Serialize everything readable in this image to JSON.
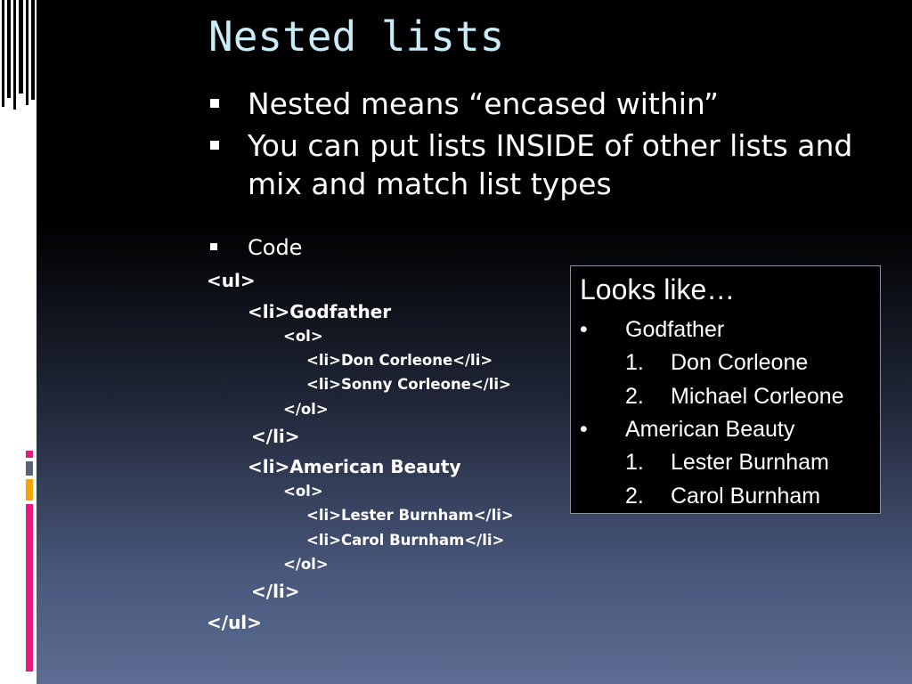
{
  "slide": {
    "title": "Nested lists",
    "bullets": [
      "Nested means “encased within”",
      "You can put lists INSIDE of other lists and mix and match list types"
    ],
    "code_label": "Code",
    "code_lines": [
      "<ul>",
      "<li>Godfather",
      "<ol>",
      "<li>Don Corleone</li>",
      "<li>Sonny Corleone</li>",
      "</ol>",
      "</li>",
      "<li>American Beauty",
      "<ol>",
      "<li>Lester Burnham</li>",
      "<li>Carol Burnham</li>",
      "</ol>",
      "</li>",
      "</ul>"
    ]
  },
  "preview": {
    "title": "Looks like…",
    "bullet_marker": "•",
    "items": [
      {
        "label": "Godfather",
        "children": [
          {
            "marker": "1.",
            "label": "Don Corleone"
          },
          {
            "marker": "2.",
            "label": "Michael Corleone"
          }
        ]
      },
      {
        "label": "American Beauty",
        "children": [
          {
            "marker": "1.",
            "label": "Lester Burnham"
          },
          {
            "marker": "2.",
            "label": "Carol Burnham"
          }
        ]
      }
    ]
  },
  "colors": {
    "title": "#c9ecf9",
    "text": "#ffffff",
    "background_top": "#000000",
    "background_bottom": "#5d6d93",
    "accent_pink": "#e8197e",
    "accent_orange": "#f5a400",
    "accent_gray": "#6f6f6f",
    "accent_teal": "#2a8f8b"
  }
}
